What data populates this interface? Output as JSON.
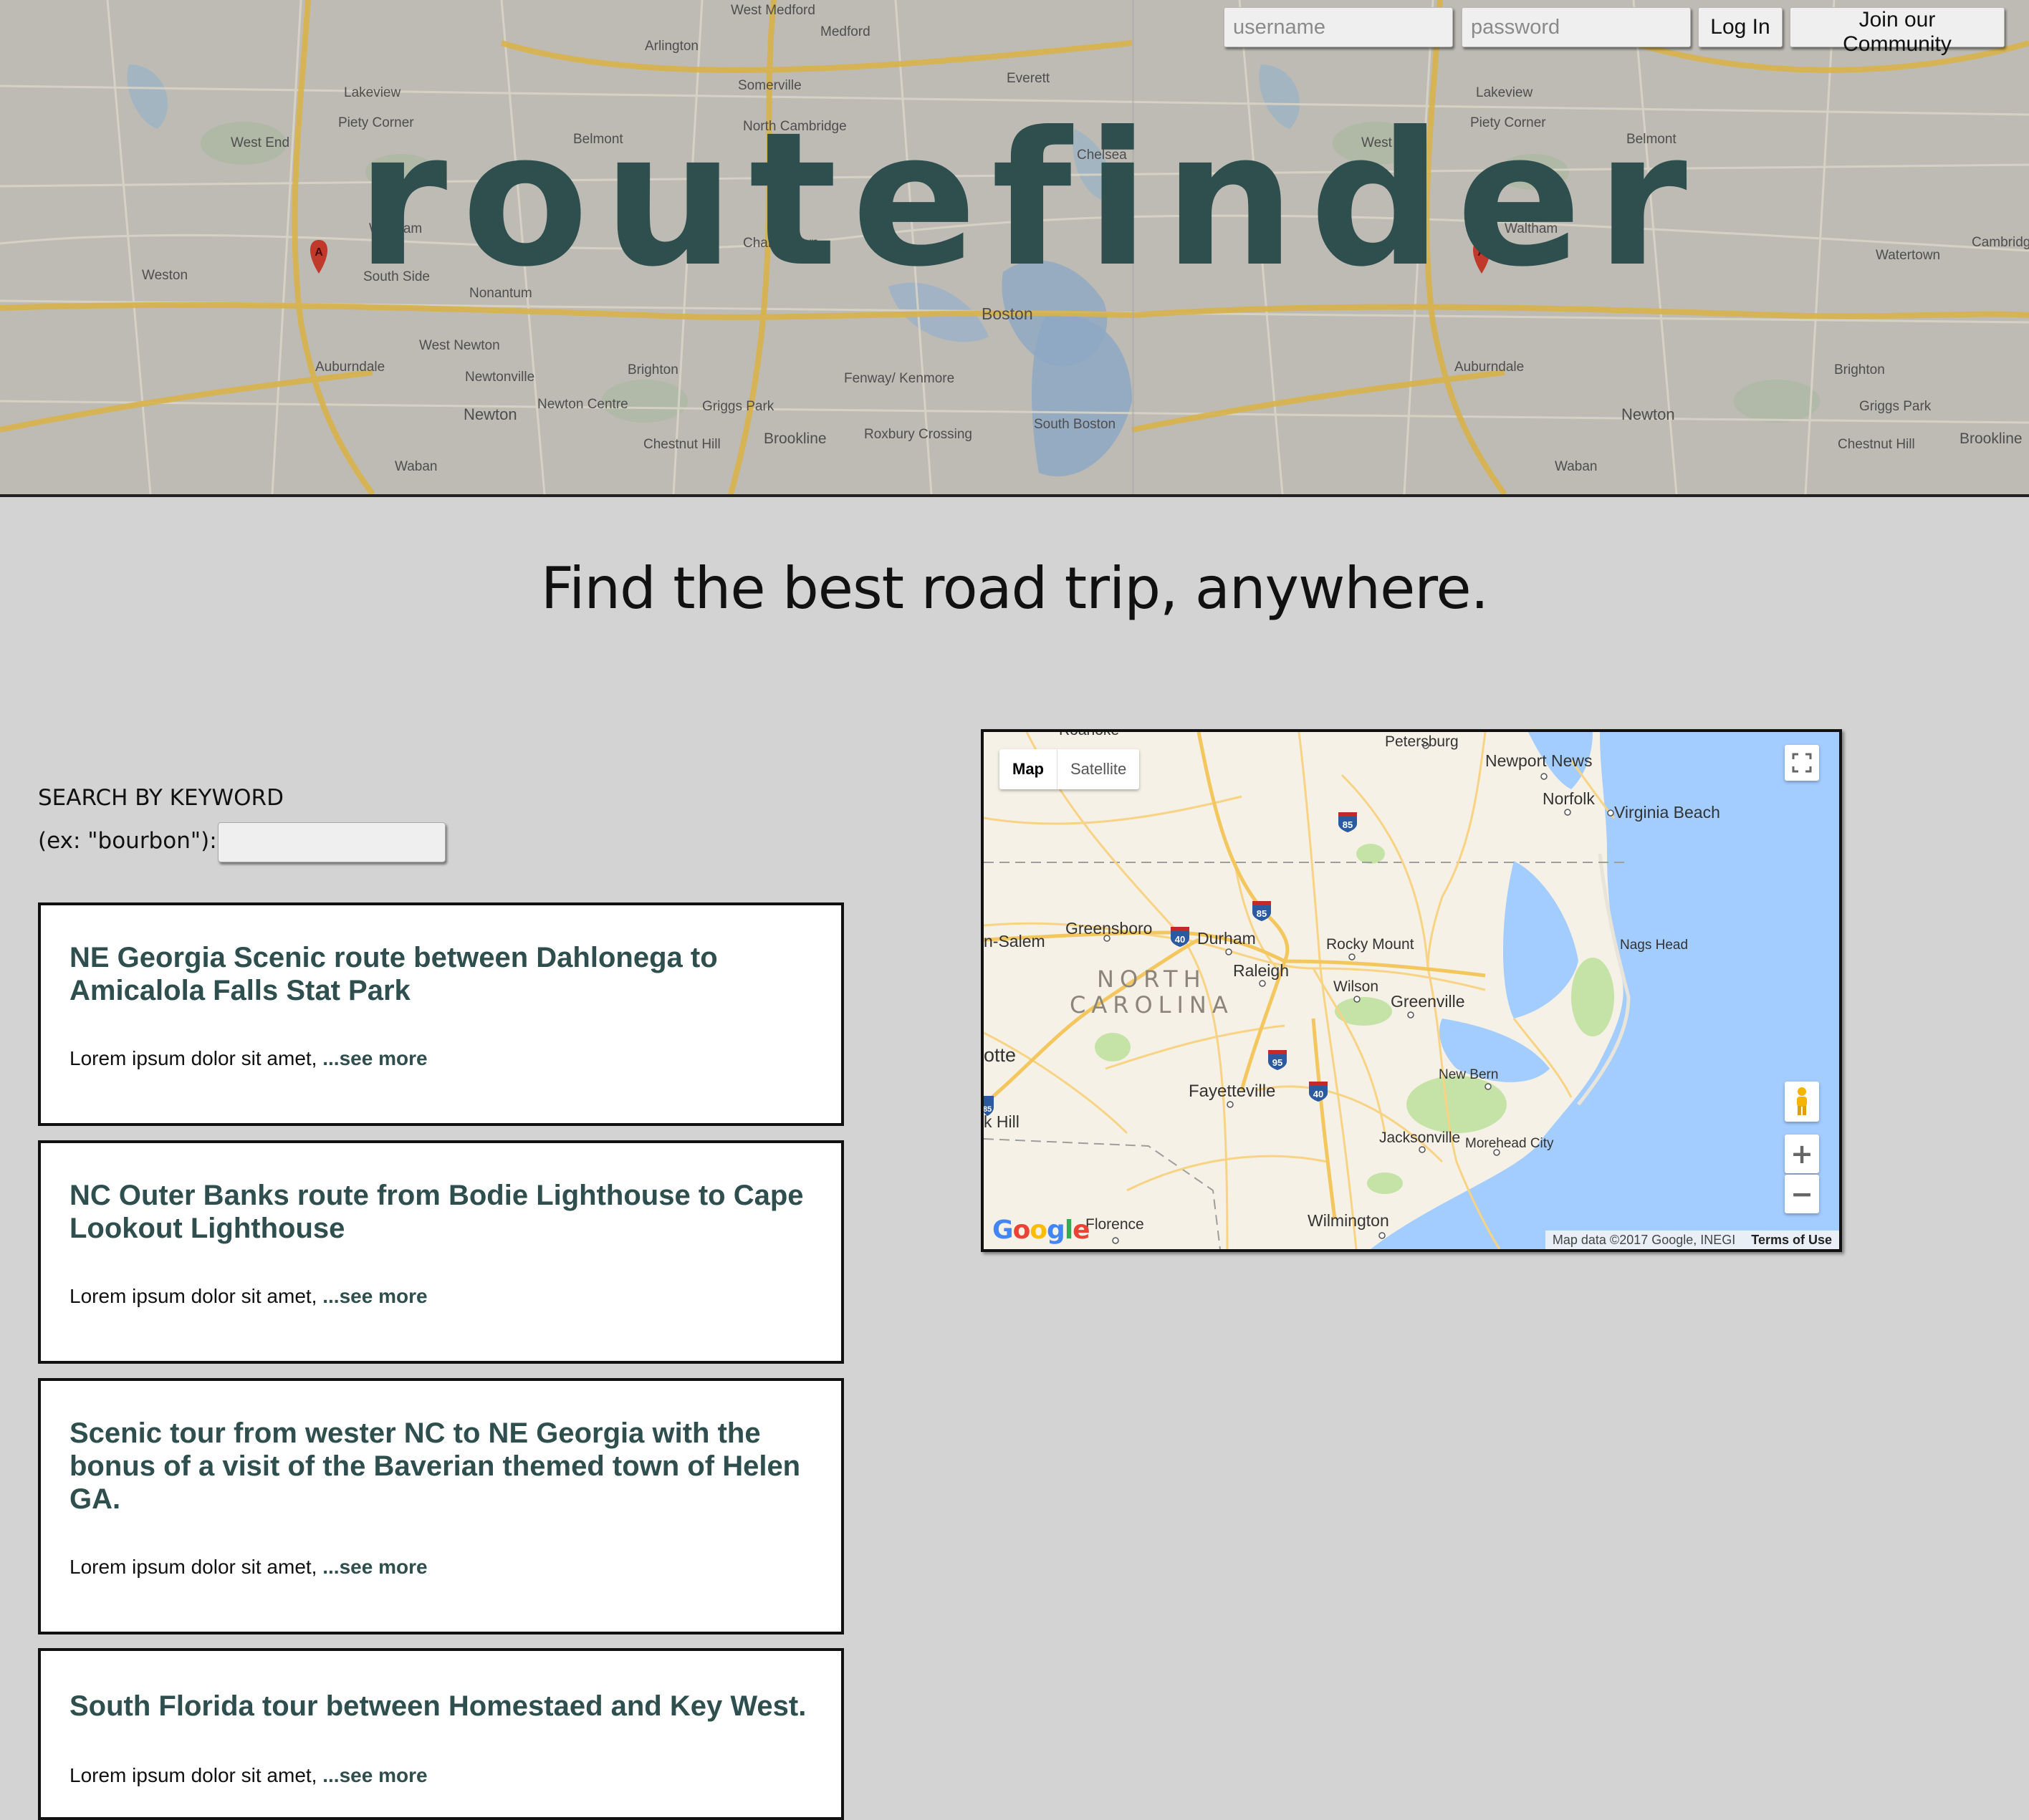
{
  "header": {
    "brand": "routefinder",
    "username_placeholder": "username",
    "password_placeholder": "password",
    "login_label": "Log In",
    "join_label": "Join our Community"
  },
  "tagline": "Find the best road trip, anywhere.",
  "search": {
    "heading": "SEARCH BY KEYWORD",
    "label": "(ex: \"bourbon\"):",
    "value": ""
  },
  "routes": [
    {
      "title": "NE Georgia Scenic route between Dahlonega to Amicalola Falls Stat Park",
      "description": "Lorem ipsum dolor sit amet, ",
      "more": "...see more"
    },
    {
      "title": "NC Outer Banks route from Bodie Lighthouse to Cape Lookout Lighthouse",
      "description": "Lorem ipsum dolor sit amet, ",
      "more": "...see more"
    },
    {
      "title": "Scenic tour from wester NC to NE Georgia with the bonus of a visit of the Baverian themed town of Helen GA.",
      "description": "Lorem ipsum dolor sit amet, ",
      "more": "...see more"
    },
    {
      "title": "South Florida tour between Homestaed and Key West.",
      "description": "Lorem ipsum dolor sit amet, ",
      "more": "...see more"
    }
  ],
  "map": {
    "type_map": "Map",
    "type_satellite": "Satellite",
    "attribution": "Map data ©2017 Google, INEGI",
    "terms": "Terms of Use",
    "logo": "Google",
    "state_label_1": "NORTH",
    "state_label_2": "CAROLINA",
    "cities": {
      "petersburg": "Petersburg",
      "roanoke": "Roanoke",
      "newport_news": "Newport News",
      "norfolk": "Norfolk",
      "virginia_beach": "Virginia Beach",
      "greensboro": "Greensboro",
      "winston_salem": "n-Salem",
      "durham": "Durham",
      "raleigh": "Raleigh",
      "rocky_mount": "Rocky Mount",
      "wilson": "Wilson",
      "greenville": "Greenville",
      "nags_head": "Nags Head",
      "charlotte": "otte",
      "rock_hill": "k Hill",
      "fayetteville": "Fayetteville",
      "new_bern": "New Bern",
      "jacksonville": "Jacksonville",
      "morehead_city": "Morehead City",
      "florence": "Florence",
      "wilmington": "Wilmington"
    },
    "shields": {
      "i85a": "85",
      "i85b": "85",
      "i40a": "40",
      "i95": "95",
      "i40b": "40",
      "i85c": "85"
    }
  },
  "header_map_labels": {
    "arlington": "Arlington",
    "medford": "Medford",
    "everett": "Everett",
    "somerville": "Somerville",
    "belmont": "Belmont",
    "waltham": "Waltham",
    "weston": "Weston",
    "lakeview": "Lakeview",
    "piety_corner": "Piety Corner",
    "west_end": "West End",
    "chelsea": "Chelsea",
    "boston": "Boston",
    "brighton": "Brighton",
    "newton": "Newton",
    "brookline": "Brookline",
    "auburndale": "Auburndale",
    "south_side": "South Side",
    "nonantum": "Nonantum",
    "watertown": "Watertown",
    "cambridge": "Cambridg",
    "griggs_park": "Griggs Park",
    "chestnut_hill": "Chestnut Hill",
    "fenway": "Fenway/ Kenmore",
    "roxbury": "Roxbury Crossing",
    "waban": "Waban",
    "newton_centre": "Newton Centre",
    "charlestown": "Charlestown",
    "west_medford": "West Medford",
    "north_cambridge": "North Cambridge",
    "south_boston": "South Boston",
    "west_newton": "West Newton",
    "newtonville": "Newtonville"
  },
  "colors": {
    "accent": "#2f4f4f",
    "page_bg": "#d3d3d3",
    "map_water": "#a3ccff",
    "map_land": "#f5f1e6"
  }
}
